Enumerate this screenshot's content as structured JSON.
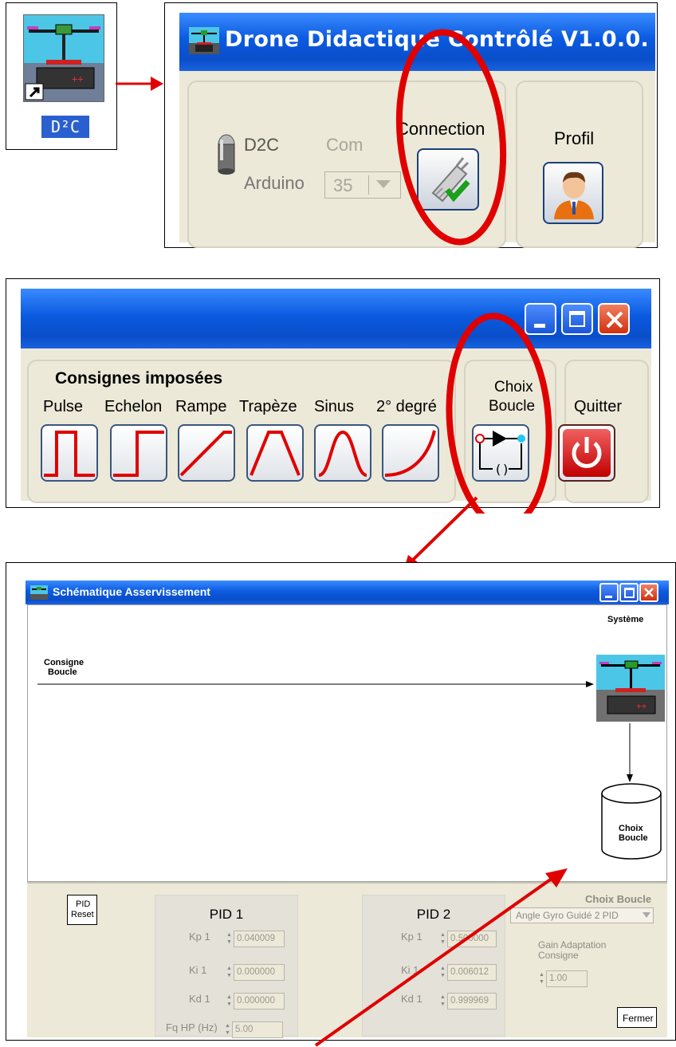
{
  "desktop_icon": {
    "label": "D²C"
  },
  "top_window": {
    "title": "Drone Didactique Contrôlé  V1.0.0.",
    "d2c_label": "D2C",
    "com_label": "Com",
    "arduino_label": "Arduino",
    "com_port_value": "35",
    "connection_label": "Connection",
    "profil_label": "Profil"
  },
  "mid_window": {
    "consignes_title": "Consignes imposées",
    "signal_labels": [
      "Pulse",
      "Echelon",
      "Rampe",
      "Trapèze",
      "Sinus",
      "2° degré"
    ],
    "choix_boucle_label_1": "Choix",
    "choix_boucle_label_2": "Boucle",
    "quitter_label": "Quitter"
  },
  "schema_window": {
    "title": "Schématique Asservissement",
    "systeme_label": "Système",
    "consigne_label_1": "Consigne",
    "consigne_label_2": "Boucle",
    "cylinder_label_1": "Choix",
    "cylinder_label_2": "Boucle",
    "pid_reset_1": "PID",
    "pid_reset_2": "Reset",
    "pid1": {
      "title": "PID 1",
      "kp_label": "Kp 1",
      "kp_value": "0.040009",
      "ki_label": "Ki 1",
      "ki_value": "0.000000",
      "kd_label": "Kd 1",
      "kd_value": "0.000000",
      "fq_label": "Fq HP (Hz)",
      "fq_value": "5.00"
    },
    "pid2": {
      "title": "PID 2",
      "kp_label": "Kp 1",
      "kp_value": "0.500000",
      "ki_label": "Ki 1",
      "ki_value": "0.006012",
      "kd_label": "Kd 1",
      "kd_value": "0.999969"
    },
    "choix_boucle_title": "Choix Boucle",
    "choix_boucle_value": "Angle Gyro Guidé 2 PID",
    "gain_label_1": "Gain Adaptation",
    "gain_label_2": "Consigne",
    "gain_value": "1.00",
    "fermer_label": "Fermer"
  },
  "colors": {
    "xp_title_blue": "#0b5ae0",
    "annotation_red": "#e00000",
    "signal_red": "#e00000"
  }
}
